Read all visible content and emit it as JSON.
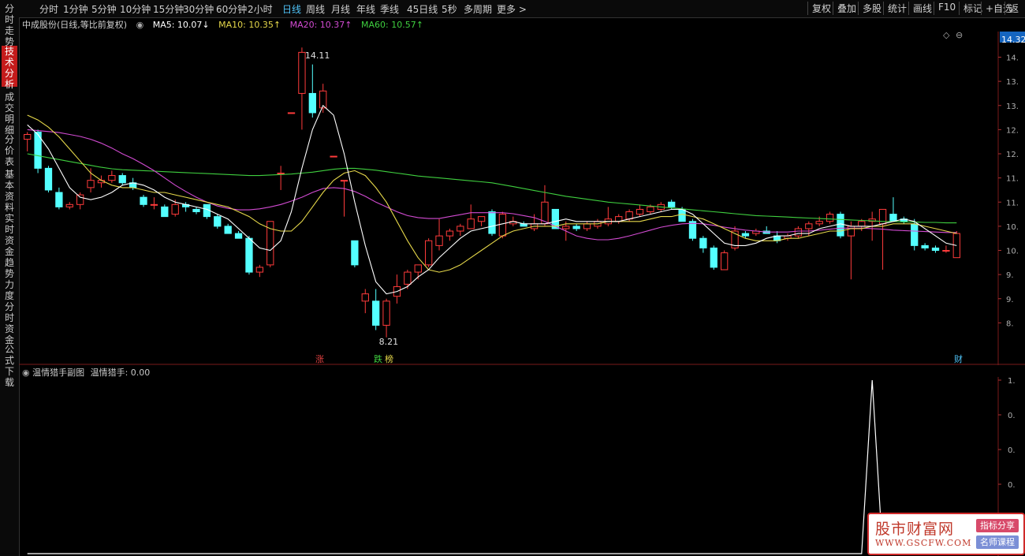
{
  "side_tabs": [
    {
      "label": "分时走势",
      "active": false
    },
    {
      "label": "技术分析",
      "active": true
    },
    {
      "label": "成交明细",
      "active": false
    },
    {
      "label": "分价表",
      "active": false
    },
    {
      "label": "基本资料",
      "active": false
    },
    {
      "label": "实时资金",
      "active": false
    },
    {
      "label": "趋势力度",
      "active": false
    },
    {
      "label": "分时资金",
      "active": false
    },
    {
      "label": "公式下载",
      "active": false
    }
  ],
  "toolbar": {
    "periods": [
      "分时",
      "1分钟",
      "5分钟",
      "10分钟",
      "15分钟",
      "30分钟",
      "60分钟",
      "2小时",
      "日线",
      "周线",
      "月线",
      "年线",
      "季线",
      "45日线",
      "5秒",
      "多周期",
      "更多 >"
    ],
    "selected_period": "日线",
    "right_buttons": [
      "复权",
      "叠加",
      "多股",
      "统计",
      "画线",
      "F10",
      "标记",
      "+自选",
      "返"
    ]
  },
  "legend": {
    "stock": "中成股份(日线,等比前复权)",
    "ma5": "MA5: 10.07↓",
    "ma10": "MA10: 10.35↑",
    "ma20": "MA20: 10.37↑",
    "ma60": "MA60: 10.57↑",
    "colors": {
      "ma5": "#ffffff",
      "ma10": "#e6d84a",
      "ma20": "#d24bd2",
      "ma60": "#3fcf3f"
    }
  },
  "price_axis": {
    "ticks": [
      "14.",
      "13.",
      "13.",
      "12.",
      "12.",
      "11.",
      "11.",
      "10.",
      "10.",
      "9.",
      "9.",
      "8."
    ],
    "current": "14.32"
  },
  "annotations": {
    "high": "14.11",
    "low": "8.21"
  },
  "markers": [
    {
      "label": "涨",
      "color": "#e04040"
    },
    {
      "label": "跌",
      "color": "#3fcf3f"
    },
    {
      "label": "榜",
      "color": "#e6d84a"
    },
    {
      "label": "财",
      "color": "#4fc3f7"
    }
  ],
  "subchart": {
    "title": "温情猎手副图",
    "value_label": "温情猎手: 0.00",
    "axis_ticks": [
      "1.",
      "0.",
      "0.",
      "0."
    ]
  },
  "watermark": {
    "name": "股市财富网",
    "url": "WWW.GSCFW.COM",
    "tag1": "指标分享",
    "tag2": "名师课程"
  },
  "chart_data": {
    "type": "candlestick",
    "ylim": [
      8.0,
      14.4
    ],
    "candles": [
      {
        "o": 12.3,
        "h": 12.45,
        "l": 12.05,
        "c": 12.4
      },
      {
        "o": 12.45,
        "h": 12.5,
        "l": 11.6,
        "c": 11.7
      },
      {
        "o": 11.7,
        "h": 11.75,
        "l": 11.2,
        "c": 11.25
      },
      {
        "o": 11.2,
        "h": 11.3,
        "l": 10.85,
        "c": 10.9
      },
      {
        "o": 10.9,
        "h": 11.0,
        "l": 10.85,
        "c": 10.95
      },
      {
        "o": 10.95,
        "h": 11.2,
        "l": 10.85,
        "c": 11.15
      },
      {
        "o": 11.3,
        "h": 11.7,
        "l": 11.2,
        "c": 11.45
      },
      {
        "o": 11.4,
        "h": 11.55,
        "l": 11.3,
        "c": 11.45
      },
      {
        "o": 11.45,
        "h": 11.65,
        "l": 11.4,
        "c": 11.55
      },
      {
        "o": 11.55,
        "h": 11.6,
        "l": 11.35,
        "c": 11.4
      },
      {
        "o": 11.4,
        "h": 11.5,
        "l": 11.25,
        "c": 11.3
      },
      {
        "o": 11.1,
        "h": 11.15,
        "l": 10.9,
        "c": 10.95
      },
      {
        "o": 10.95,
        "h": 11.1,
        "l": 10.85,
        "c": 10.95
      },
      {
        "o": 10.9,
        "h": 10.95,
        "l": 10.7,
        "c": 10.7
      },
      {
        "o": 10.75,
        "h": 11.05,
        "l": 10.7,
        "c": 10.95
      },
      {
        "o": 10.95,
        "h": 11.0,
        "l": 10.8,
        "c": 10.9
      },
      {
        "o": 10.85,
        "h": 10.9,
        "l": 10.75,
        "c": 10.8
      },
      {
        "o": 10.95,
        "h": 10.95,
        "l": 10.65,
        "c": 10.7
      },
      {
        "o": 10.7,
        "h": 10.75,
        "l": 10.45,
        "c": 10.5
      },
      {
        "o": 10.5,
        "h": 10.55,
        "l": 10.35,
        "c": 10.35
      },
      {
        "o": 10.35,
        "h": 10.4,
        "l": 10.25,
        "c": 10.25
      },
      {
        "o": 10.25,
        "h": 10.3,
        "l": 9.5,
        "c": 9.55
      },
      {
        "o": 9.55,
        "h": 9.7,
        "l": 9.45,
        "c": 9.65
      },
      {
        "o": 9.7,
        "h": 10.6,
        "l": 9.65,
        "c": 10.6
      },
      {
        "o": 11.6,
        "h": 11.75,
        "l": 11.25,
        "c": 11.6
      },
      {
        "o": 12.85,
        "h": 12.85,
        "l": 12.85,
        "c": 12.85
      },
      {
        "o": 13.25,
        "h": 14.2,
        "l": 12.5,
        "c": 14.1
      },
      {
        "o": 13.25,
        "h": 13.85,
        "l": 12.75,
        "c": 12.85
      },
      {
        "o": 12.95,
        "h": 13.45,
        "l": 12.85,
        "c": 13.3
      },
      {
        "o": 11.95,
        "h": 11.95,
        "l": 11.95,
        "c": 11.95
      },
      {
        "o": 11.45,
        "h": 11.45,
        "l": 10.7,
        "c": 11.45
      },
      {
        "o": 10.2,
        "h": 10.2,
        "l": 9.65,
        "c": 9.7
      },
      {
        "o": 8.95,
        "h": 9.2,
        "l": 8.7,
        "c": 9.1
      },
      {
        "o": 8.95,
        "h": 9.2,
        "l": 8.35,
        "c": 8.45
      },
      {
        "o": 8.45,
        "h": 9.0,
        "l": 8.2,
        "c": 8.95
      },
      {
        "o": 9.05,
        "h": 9.5,
        "l": 8.9,
        "c": 9.25
      },
      {
        "o": 9.3,
        "h": 9.6,
        "l": 9.2,
        "c": 9.55
      },
      {
        "o": 9.55,
        "h": 9.7,
        "l": 9.4,
        "c": 9.7
      },
      {
        "o": 9.7,
        "h": 10.25,
        "l": 9.65,
        "c": 10.2
      },
      {
        "o": 10.1,
        "h": 10.65,
        "l": 10.0,
        "c": 10.3
      },
      {
        "o": 10.3,
        "h": 10.45,
        "l": 10.2,
        "c": 10.4
      },
      {
        "o": 10.4,
        "h": 10.55,
        "l": 10.3,
        "c": 10.5
      },
      {
        "o": 10.45,
        "h": 10.95,
        "l": 10.45,
        "c": 10.65
      },
      {
        "o": 10.6,
        "h": 10.7,
        "l": 10.5,
        "c": 10.7
      },
      {
        "o": 10.8,
        "h": 10.85,
        "l": 10.3,
        "c": 10.35
      },
      {
        "o": 10.3,
        "h": 10.8,
        "l": 10.25,
        "c": 10.75
      },
      {
        "o": 10.55,
        "h": 10.7,
        "l": 10.5,
        "c": 10.6
      },
      {
        "o": 10.55,
        "h": 10.6,
        "l": 10.5,
        "c": 10.5
      },
      {
        "o": 10.45,
        "h": 10.75,
        "l": 10.4,
        "c": 10.55
      },
      {
        "o": 10.55,
        "h": 11.35,
        "l": 10.5,
        "c": 11.0
      },
      {
        "o": 10.85,
        "h": 10.85,
        "l": 10.5,
        "c": 10.45
      },
      {
        "o": 10.45,
        "h": 10.6,
        "l": 10.2,
        "c": 10.5
      },
      {
        "o": 10.5,
        "h": 10.55,
        "l": 10.4,
        "c": 10.45
      },
      {
        "o": 10.45,
        "h": 10.6,
        "l": 10.4,
        "c": 10.55
      },
      {
        "o": 10.5,
        "h": 10.65,
        "l": 10.45,
        "c": 10.6
      },
      {
        "o": 10.55,
        "h": 10.9,
        "l": 10.5,
        "c": 10.65
      },
      {
        "o": 10.6,
        "h": 10.75,
        "l": 10.55,
        "c": 10.7
      },
      {
        "o": 10.65,
        "h": 10.85,
        "l": 10.6,
        "c": 10.8
      },
      {
        "o": 10.75,
        "h": 10.95,
        "l": 10.7,
        "c": 10.85
      },
      {
        "o": 10.8,
        "h": 10.95,
        "l": 10.75,
        "c": 10.9
      },
      {
        "o": 10.85,
        "h": 11.0,
        "l": 10.8,
        "c": 10.95
      },
      {
        "o": 11.0,
        "h": 11.05,
        "l": 10.85,
        "c": 10.9
      },
      {
        "o": 10.85,
        "h": 10.9,
        "l": 10.6,
        "c": 10.6
      },
      {
        "o": 10.6,
        "h": 10.65,
        "l": 10.2,
        "c": 10.25
      },
      {
        "o": 10.25,
        "h": 10.3,
        "l": 9.95,
        "c": 10.05
      },
      {
        "o": 10.05,
        "h": 10.1,
        "l": 9.6,
        "c": 9.65
      },
      {
        "o": 9.6,
        "h": 10.0,
        "l": 9.6,
        "c": 9.95
      },
      {
        "o": 10.05,
        "h": 10.5,
        "l": 10.0,
        "c": 10.4
      },
      {
        "o": 10.35,
        "h": 10.4,
        "l": 10.25,
        "c": 10.3
      },
      {
        "o": 10.35,
        "h": 10.45,
        "l": 10.3,
        "c": 10.4
      },
      {
        "o": 10.4,
        "h": 10.5,
        "l": 10.35,
        "c": 10.35
      },
      {
        "o": 10.3,
        "h": 10.4,
        "l": 10.15,
        "c": 10.2
      },
      {
        "o": 10.25,
        "h": 10.35,
        "l": 10.2,
        "c": 10.3
      },
      {
        "o": 10.3,
        "h": 10.5,
        "l": 10.25,
        "c": 10.45
      },
      {
        "o": 10.45,
        "h": 10.6,
        "l": 10.3,
        "c": 10.55
      },
      {
        "o": 10.55,
        "h": 10.7,
        "l": 10.5,
        "c": 10.6
      },
      {
        "o": 10.6,
        "h": 10.8,
        "l": 10.55,
        "c": 10.75
      },
      {
        "o": 10.75,
        "h": 10.8,
        "l": 10.25,
        "c": 10.3
      },
      {
        "o": 10.3,
        "h": 10.6,
        "l": 9.4,
        "c": 10.5
      },
      {
        "o": 10.5,
        "h": 10.65,
        "l": 10.4,
        "c": 10.6
      },
      {
        "o": 10.6,
        "h": 10.8,
        "l": 10.2,
        "c": 10.65
      },
      {
        "o": 10.55,
        "h": 10.85,
        "l": 9.6,
        "c": 10.85
      },
      {
        "o": 10.75,
        "h": 11.1,
        "l": 10.6,
        "c": 10.6
      },
      {
        "o": 10.65,
        "h": 10.7,
        "l": 10.55,
        "c": 10.6
      },
      {
        "o": 10.55,
        "h": 10.65,
        "l": 10.0,
        "c": 10.1
      },
      {
        "o": 10.1,
        "h": 10.15,
        "l": 10.0,
        "c": 10.05
      },
      {
        "o": 10.05,
        "h": 10.1,
        "l": 9.95,
        "c": 10.0
      },
      {
        "o": 10.0,
        "h": 10.1,
        "l": 9.95,
        "c": 10.0
      },
      {
        "o": 9.85,
        "h": 10.4,
        "l": 9.85,
        "c": 10.35
      }
    ],
    "ma5": [
      12.6,
      12.4,
      12.1,
      11.7,
      11.3,
      11.1,
      11.05,
      11.1,
      11.2,
      11.35,
      11.4,
      11.35,
      11.25,
      11.1,
      11.0,
      10.95,
      10.9,
      10.85,
      10.75,
      10.65,
      10.45,
      10.25,
      10.05,
      10.0,
      10.2,
      10.8,
      11.7,
      12.5,
      13.0,
      12.8,
      12.0,
      11.0,
      10.1,
      9.35,
      9.1,
      9.15,
      9.25,
      9.45,
      9.6,
      9.85,
      10.05,
      10.25,
      10.4,
      10.45,
      10.5,
      10.55,
      10.6,
      10.55,
      10.55,
      10.55,
      10.6,
      10.65,
      10.6,
      10.6,
      10.6,
      10.6,
      10.6,
      10.65,
      10.7,
      10.75,
      10.8,
      10.85,
      10.85,
      10.75,
      10.55,
      10.35,
      10.15,
      10.1,
      10.1,
      10.15,
      10.25,
      10.3,
      10.3,
      10.35,
      10.35,
      10.45,
      10.5,
      10.55,
      10.5,
      10.5,
      10.5,
      10.55,
      10.6,
      10.65,
      10.6,
      10.45,
      10.3,
      10.15,
      10.1
    ],
    "ma10": [
      12.8,
      12.7,
      12.55,
      12.35,
      12.1,
      11.85,
      11.6,
      11.45,
      11.35,
      11.3,
      11.3,
      11.25,
      11.2,
      11.2,
      11.15,
      11.1,
      11.05,
      11.0,
      10.95,
      10.9,
      10.8,
      10.7,
      10.55,
      10.45,
      10.4,
      10.4,
      10.6,
      10.9,
      11.2,
      11.45,
      11.6,
      11.65,
      11.55,
      11.3,
      11.0,
      10.6,
      10.2,
      9.85,
      9.6,
      9.55,
      9.6,
      9.7,
      9.85,
      10.0,
      10.15,
      10.3,
      10.4,
      10.45,
      10.5,
      10.5,
      10.5,
      10.55,
      10.55,
      10.55,
      10.55,
      10.6,
      10.6,
      10.6,
      10.6,
      10.65,
      10.7,
      10.7,
      10.75,
      10.7,
      10.65,
      10.55,
      10.45,
      10.35,
      10.25,
      10.2,
      10.2,
      10.2,
      10.25,
      10.25,
      10.3,
      10.35,
      10.4,
      10.4,
      10.45,
      10.45,
      10.5,
      10.5,
      10.55,
      10.55,
      10.55,
      10.5,
      10.45,
      10.4,
      10.35
    ],
    "ma20": [
      12.5,
      12.48,
      12.46,
      12.44,
      12.4,
      12.36,
      12.3,
      12.22,
      12.12,
      12.0,
      11.9,
      11.78,
      11.65,
      11.5,
      11.35,
      11.22,
      11.1,
      11.0,
      10.92,
      10.87,
      10.84,
      10.84,
      10.86,
      10.9,
      10.95,
      11.02,
      11.1,
      11.2,
      11.28,
      11.3,
      11.28,
      11.22,
      11.12,
      11.0,
      10.9,
      10.8,
      10.72,
      10.68,
      10.66,
      10.66,
      10.7,
      10.74,
      10.78,
      10.78,
      10.78,
      10.78,
      10.76,
      10.72,
      10.68,
      10.6,
      10.5,
      10.4,
      10.3,
      10.25,
      10.22,
      10.22,
      10.25,
      10.3,
      10.36,
      10.42,
      10.48,
      10.52,
      10.55,
      10.56,
      10.55,
      10.52,
      10.48,
      10.45,
      10.42,
      10.4,
      10.38,
      10.38,
      10.38,
      10.4,
      10.4,
      10.42,
      10.44,
      10.46,
      10.46,
      10.46,
      10.45,
      10.44,
      10.42,
      10.41,
      10.4,
      10.39,
      10.38,
      10.37,
      10.37
    ],
    "ma60": [
      12.0,
      11.96,
      11.92,
      11.88,
      11.84,
      11.8,
      11.76,
      11.72,
      11.69,
      11.67,
      11.66,
      11.65,
      11.64,
      11.63,
      11.62,
      11.61,
      11.6,
      11.59,
      11.58,
      11.57,
      11.56,
      11.55,
      11.55,
      11.56,
      11.57,
      11.58,
      11.6,
      11.62,
      11.65,
      11.68,
      11.7,
      11.7,
      11.68,
      11.66,
      11.63,
      11.6,
      11.57,
      11.54,
      11.52,
      11.5,
      11.48,
      11.46,
      11.44,
      11.42,
      11.4,
      11.36,
      11.32,
      11.28,
      11.24,
      11.2,
      11.16,
      11.12,
      11.09,
      11.06,
      11.03,
      11.0,
      10.98,
      10.96,
      10.94,
      10.92,
      10.9,
      10.88,
      10.86,
      10.84,
      10.82,
      10.8,
      10.78,
      10.76,
      10.74,
      10.72,
      10.71,
      10.7,
      10.69,
      10.68,
      10.67,
      10.66,
      10.65,
      10.64,
      10.63,
      10.62,
      10.61,
      10.6,
      10.6,
      10.59,
      10.59,
      10.58,
      10.58,
      10.57,
      10.57
    ],
    "sub_indicator": {
      "name": "温情猎手",
      "spike_index": 80,
      "spike_value": 1.0
    }
  }
}
